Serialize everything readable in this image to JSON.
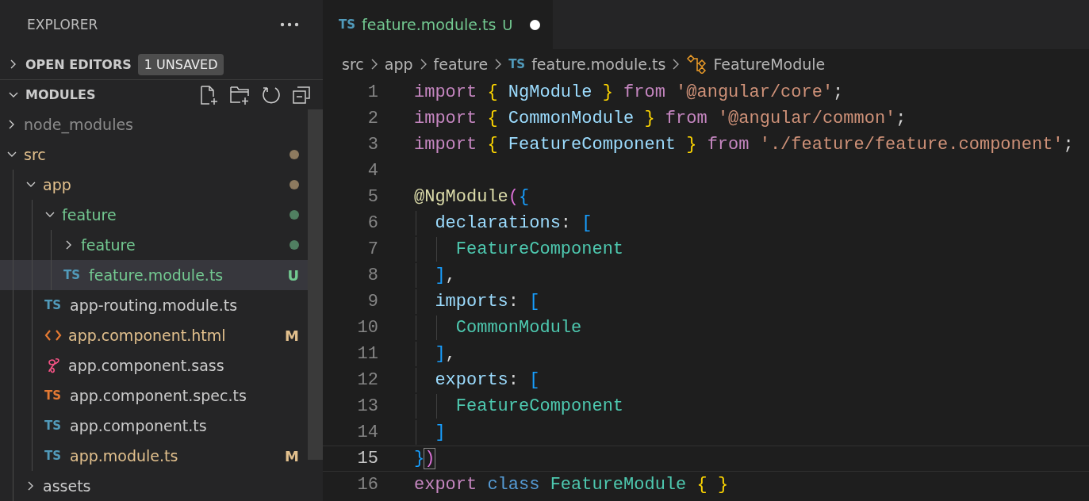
{
  "explorer": {
    "title": "EXPLORER",
    "sections": [
      {
        "title": "OPEN EDITORS",
        "badge": "1 UNSAVED",
        "expanded": false
      },
      {
        "title": "MODULES",
        "expanded": true,
        "tree": [
          {
            "name": "node_modules",
            "kind": "folder",
            "expanded": false,
            "selected": false,
            "color": "#8c8c8c"
          },
          {
            "name": "src",
            "kind": "folder",
            "expanded": true,
            "selected": false,
            "color": "#e2c08d",
            "dot": true,
            "children": [
              {
                "name": "app",
                "kind": "folder",
                "expanded": true,
                "selected": false,
                "color": "#e2c08d",
                "dot": true,
                "children": [
                  {
                    "name": "feature",
                    "kind": "folder",
                    "expanded": true,
                    "selected": false,
                    "color": "#73c991",
                    "dot": true,
                    "children": [
                      {
                        "name": "feature",
                        "kind": "folder",
                        "expanded": false,
                        "selected": false,
                        "color": "#73c991",
                        "dot": true
                      },
                      {
                        "name": "feature.module.ts",
                        "kind": "ts",
                        "icon_text": "TS",
                        "selected": true,
                        "color": "#73c991",
                        "status": "U"
                      }
                    ]
                  },
                  {
                    "name": "app-routing.module.ts",
                    "kind": "ts",
                    "icon_text": "TS",
                    "selected": false,
                    "color": "#cccccc"
                  },
                  {
                    "name": "app.component.html",
                    "kind": "html",
                    "selected": false,
                    "color": "#e2c08d",
                    "status": "M"
                  },
                  {
                    "name": "app.component.sass",
                    "kind": "sass",
                    "selected": false,
                    "color": "#cccccc"
                  },
                  {
                    "name": "app.component.spec.ts",
                    "kind": "spec",
                    "icon_text": "TS",
                    "selected": false,
                    "color": "#cccccc"
                  },
                  {
                    "name": "app.component.ts",
                    "kind": "ts",
                    "icon_text": "TS",
                    "selected": false,
                    "color": "#cccccc"
                  },
                  {
                    "name": "app.module.ts",
                    "kind": "ts",
                    "icon_text": "TS",
                    "selected": false,
                    "color": "#e2c08d",
                    "status": "M"
                  }
                ]
              },
              {
                "name": "assets",
                "kind": "folder",
                "expanded": false,
                "selected": false,
                "color": "#cccccc"
              }
            ]
          }
        ]
      }
    ]
  },
  "tabs": [
    {
      "icon_text": "TS",
      "label": "feature.module.ts",
      "status": "U",
      "color": "#73c991",
      "unsaved": true,
      "selected": true
    }
  ],
  "breadcrumb": [
    {
      "label": "src",
      "kind": "folder"
    },
    {
      "label": "app",
      "kind": "folder"
    },
    {
      "label": "feature",
      "kind": "folder"
    },
    {
      "label": "feature.module.ts",
      "kind": "ts",
      "icon_text": "TS"
    },
    {
      "label": "FeatureModule",
      "kind": "class"
    }
  ],
  "code": [
    {
      "number": "1",
      "current": false,
      "tokens": [
        {
          "t": "import",
          "color": "#c586c0"
        },
        {
          "t": " {",
          "color": "#ffd700"
        },
        {
          "t": " NgModule",
          "color": "#9cdcfe"
        },
        {
          "t": " }",
          "color": "#ffd700"
        },
        {
          "t": " from",
          "color": "#c586c0"
        },
        {
          "t": " '@angular/core'",
          "color": "#ce9178"
        },
        {
          "t": ";",
          "color": "#d4d4d4"
        }
      ]
    },
    {
      "number": "2",
      "current": false,
      "tokens": [
        {
          "t": "import",
          "color": "#c586c0"
        },
        {
          "t": " {",
          "color": "#ffd700"
        },
        {
          "t": " CommonModule",
          "color": "#9cdcfe"
        },
        {
          "t": " }",
          "color": "#ffd700"
        },
        {
          "t": " from",
          "color": "#c586c0"
        },
        {
          "t": " '@angular/common'",
          "color": "#ce9178"
        },
        {
          "t": ";",
          "color": "#d4d4d4"
        }
      ]
    },
    {
      "number": "3",
      "current": false,
      "tokens": [
        {
          "t": "import",
          "color": "#c586c0"
        },
        {
          "t": " {",
          "color": "#ffd700"
        },
        {
          "t": " FeatureComponent",
          "color": "#9cdcfe"
        },
        {
          "t": " }",
          "color": "#ffd700"
        },
        {
          "t": " from",
          "color": "#c586c0"
        },
        {
          "t": " './feature/feature.component'",
          "color": "#ce9178"
        },
        {
          "t": ";",
          "color": "#d4d4d4"
        }
      ]
    },
    {
      "number": "4",
      "current": false
    },
    {
      "number": "5",
      "current": false,
      "tokens": [
        {
          "t": "@NgModule",
          "color": "#dcdcaa"
        },
        {
          "t": "(",
          "color": "#da70d6"
        },
        {
          "t": "{",
          "color": "#179fff"
        }
      ]
    },
    {
      "number": "6",
      "current": false,
      "tokens": [
        {
          "t": "  declarations",
          "color": "#9cdcfe"
        },
        {
          "t": ":",
          "color": "#d4d4d4"
        },
        {
          "t": " [",
          "color": "#179fff"
        }
      ]
    },
    {
      "number": "7",
      "current": false,
      "tokens": [
        {
          "t": "    FeatureComponent",
          "color": "#4ec9b0"
        }
      ]
    },
    {
      "number": "8",
      "current": false,
      "tokens": [
        {
          "t": "  ]",
          "color": "#179fff"
        },
        {
          "t": ",",
          "color": "#d4d4d4"
        }
      ]
    },
    {
      "number": "9",
      "current": false,
      "tokens": [
        {
          "t": "  imports",
          "color": "#9cdcfe"
        },
        {
          "t": ":",
          "color": "#d4d4d4"
        },
        {
          "t": " [",
          "color": "#179fff"
        }
      ]
    },
    {
      "number": "10",
      "current": false,
      "tokens": [
        {
          "t": "    CommonModule",
          "color": "#4ec9b0"
        }
      ]
    },
    {
      "number": "11",
      "current": false,
      "tokens": [
        {
          "t": "  ]",
          "color": "#179fff"
        },
        {
          "t": ",",
          "color": "#d4d4d4"
        }
      ]
    },
    {
      "number": "12",
      "current": false,
      "tokens": [
        {
          "t": "  exports",
          "color": "#9cdcfe"
        },
        {
          "t": ":",
          "color": "#d4d4d4"
        },
        {
          "t": " [",
          "color": "#179fff"
        }
      ]
    },
    {
      "number": "13",
      "current": false,
      "tokens": [
        {
          "t": "    FeatureComponent",
          "color": "#4ec9b0"
        }
      ]
    },
    {
      "number": "14",
      "current": false,
      "tokens": [
        {
          "t": "  ]",
          "color": "#179fff"
        }
      ]
    },
    {
      "number": "15",
      "current": true,
      "tokens": [
        {
          "t": "}",
          "color": "#179fff"
        },
        {
          "t": ")",
          "color": "#da70d6"
        }
      ]
    },
    {
      "number": "16",
      "current": false,
      "tokens": [
        {
          "t": "export",
          "color": "#c586c0"
        },
        {
          "t": " class",
          "color": "#569cd6"
        },
        {
          "t": " FeatureModule",
          "color": "#4ec9b0"
        },
        {
          "t": " { }",
          "color": "#ffd700"
        }
      ]
    }
  ]
}
